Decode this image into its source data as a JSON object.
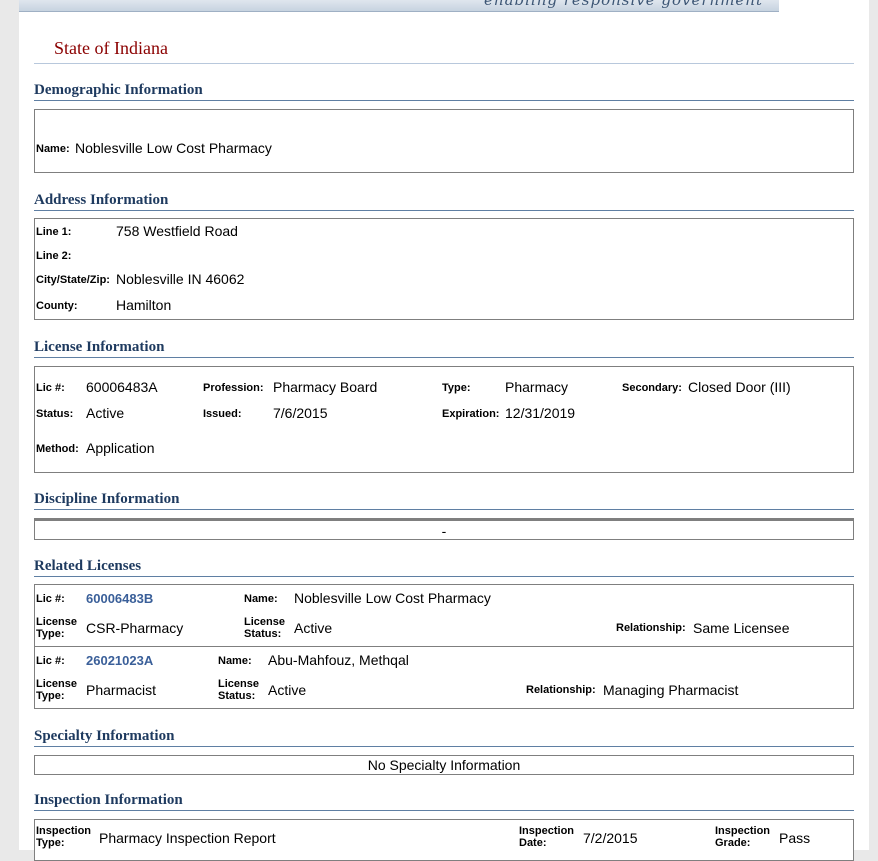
{
  "banner": {
    "tagline": "enabling responsive government"
  },
  "state": {
    "title": "State of Indiana"
  },
  "demographic": {
    "heading": "Demographic Information",
    "name_label": "Name:",
    "name": "Noblesville Low Cost Pharmacy"
  },
  "address": {
    "heading": "Address Information",
    "line1_label": "Line 1:",
    "line1": "758 Westfield Road",
    "line2_label": "Line 2:",
    "line2": "",
    "csz_label": "City/State/Zip:",
    "csz": "Noblesville IN 46062",
    "county_label": "County:",
    "county": "Hamilton"
  },
  "license": {
    "heading": "License Information",
    "lic_label": "Lic #:",
    "lic": "60006483A",
    "profession_label": "Profession:",
    "profession": "Pharmacy Board",
    "type_label": "Type:",
    "type": "Pharmacy",
    "secondary_label": "Secondary:",
    "secondary": "Closed Door (III)",
    "status_label": "Status:",
    "status": "Active",
    "issued_label": "Issued:",
    "issued": "7/6/2015",
    "expiration_label": "Expiration:",
    "expiration": "12/31/2019",
    "method_label": "Method:",
    "method": "Application"
  },
  "discipline": {
    "heading": "Discipline Information",
    "value": "-"
  },
  "related": {
    "heading": "Related Licenses",
    "items": [
      {
        "lic_label": "Lic #:",
        "lic": "60006483B",
        "name_label": "Name:",
        "name": "Noblesville Low Cost Pharmacy",
        "type_label_1": "License",
        "type_label_2": "Type:",
        "type": "CSR-Pharmacy",
        "status_label_1": "License",
        "status_label_2": "Status:",
        "status": "Active",
        "relationship_label": "Relationship:",
        "relationship": "Same Licensee"
      },
      {
        "lic_label": "Lic #:",
        "lic": "26021023A",
        "name_label": "Name:",
        "name": "Abu-Mahfouz, Methqal",
        "type_label_1": "License",
        "type_label_2": "Type:",
        "type": "Pharmacist",
        "status_label_1": "License",
        "status_label_2": "Status:",
        "status": "Active",
        "relationship_label": "Relationship:",
        "relationship": "Managing Pharmacist"
      }
    ]
  },
  "specialty": {
    "heading": "Specialty Information",
    "value": "No Specialty Information"
  },
  "inspection": {
    "heading": "Inspection Information",
    "type_label_1": "Inspection",
    "type_label_2": "Type:",
    "type": "Pharmacy Inspection Report",
    "date_label_1": "Inspection",
    "date_label_2": "Date:",
    "date": "7/2/2015",
    "grade_label_1": "Inspection",
    "grade_label_2": "Grade:",
    "grade": "Pass"
  }
}
